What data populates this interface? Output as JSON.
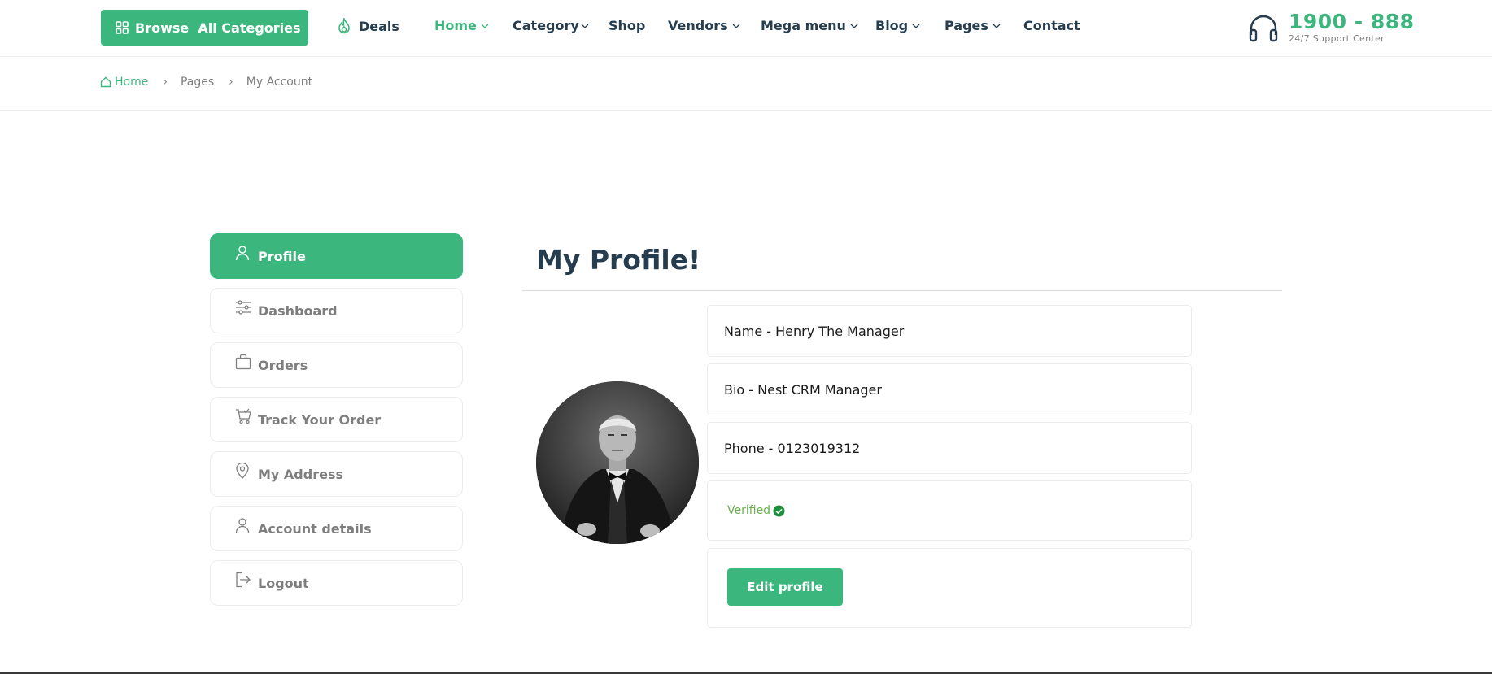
{
  "header": {
    "browse_label": "Browse  All Categories",
    "nav": {
      "deals": "Deals",
      "home": "Home",
      "category": "Category",
      "shop": "Shop",
      "vendors": "Vendors",
      "mega_menu": "Mega menu",
      "blog": "Blog",
      "pages": "Pages",
      "contact": "Contact"
    },
    "support_phone": "1900 - 888",
    "support_label": "24/7 Support Center"
  },
  "breadcrumb": {
    "home": "Home",
    "pages": "Pages",
    "current": "My Account",
    "separator": "›"
  },
  "sidebar": {
    "items": [
      {
        "label": "Profile",
        "icon": "user-icon",
        "active": true
      },
      {
        "label": "Dashboard",
        "icon": "sliders-icon",
        "active": false
      },
      {
        "label": "Orders",
        "icon": "bag-icon",
        "active": false
      },
      {
        "label": "Track Your Order",
        "icon": "cart-icon",
        "active": false
      },
      {
        "label": "My Address",
        "icon": "map-pin-icon",
        "active": false
      },
      {
        "label": "Account details",
        "icon": "user-icon",
        "active": false
      },
      {
        "label": "Logout",
        "icon": "logout-icon",
        "active": false
      }
    ]
  },
  "profile": {
    "title": "My Profile!",
    "name": "Name - Henry The Manager",
    "bio": "Bio - Nest CRM Manager",
    "phone": "Phone - 0123019312",
    "status": "Verified",
    "edit_label": "Edit profile"
  },
  "colors": {
    "accent": "#3bb77e",
    "heading": "#253d4e",
    "muted": "#7e7e7e",
    "verified": "#6ab04c"
  }
}
